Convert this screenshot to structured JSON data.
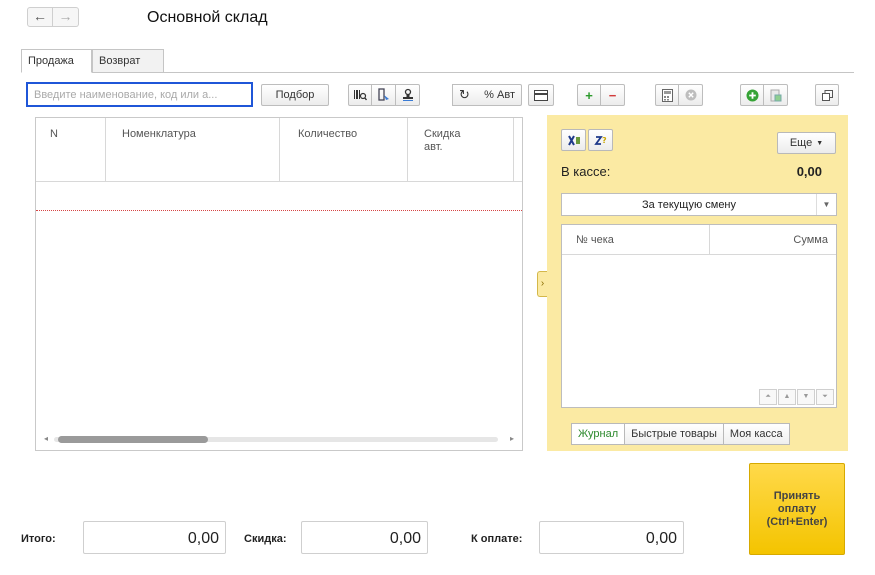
{
  "window": {
    "title": "Основной склад"
  },
  "nav": {
    "back_glyph": "←",
    "forward_glyph": "→"
  },
  "tabs": [
    {
      "label": "Продажа",
      "active": true
    },
    {
      "label": "Возврат",
      "active": false
    }
  ],
  "toolbar": {
    "search_placeholder": "Введите наименование, код или а...",
    "pick_label": "Подбор",
    "auto_discount_label": "% Авт",
    "plus_glyph": "+",
    "minus_glyph": "−"
  },
  "table": {
    "columns": [
      "N",
      "Номенклатура",
      "Количество",
      "Скидка авт."
    ],
    "rows": []
  },
  "panel": {
    "more_label": "Еще",
    "in_cash_label": "В кассе:",
    "in_cash_value": "0,00",
    "period_value": "За текущую смену",
    "checks_columns": [
      "№ чека",
      "Сумма"
    ],
    "tabs": [
      {
        "label": "Журнал",
        "active": true
      },
      {
        "label": "Быстрые товары",
        "active": false
      },
      {
        "label": "Моя касса",
        "active": false
      }
    ]
  },
  "totals": {
    "total_label": "Итого:",
    "total_value": "0,00",
    "discount_label": "Скидка:",
    "discount_value": "0,00",
    "to_pay_label": "К оплате:",
    "to_pay_value": "0,00"
  },
  "pay_button": {
    "label": "Принять оплату (Ctrl+Enter)"
  },
  "colors": {
    "accent_blue": "#1f56d8",
    "panel_yellow": "#fbeaa3",
    "pay_yellow": "#f4c400",
    "active_green": "#2d8a2d"
  },
  "icons": [
    "arrow-left-icon",
    "arrow-right-icon",
    "barcode-search-icon",
    "scan-icon",
    "stamp-icon",
    "refresh-icon",
    "card-icon",
    "add-icon",
    "remove-icon",
    "calculator-icon",
    "cancel-icon",
    "green-plus-icon",
    "print-icon",
    "window-icon",
    "excel-icon",
    "sort-icon",
    "dropdown-icon"
  ]
}
